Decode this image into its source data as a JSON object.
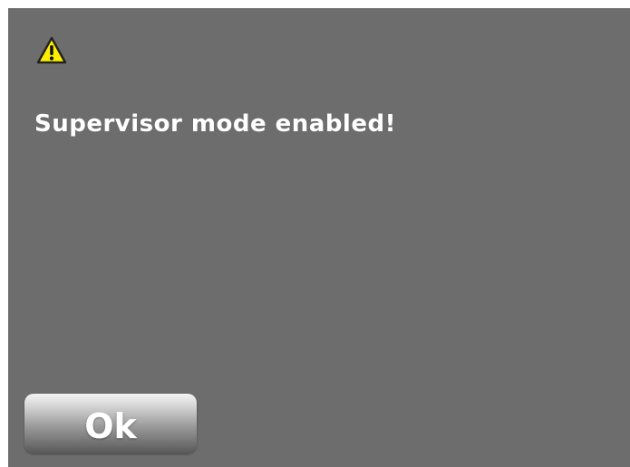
{
  "dialog": {
    "icon": "warning-icon",
    "message": "Supervisor mode enabled!",
    "ok_label": "Ok"
  },
  "colors": {
    "dialog_background": "#6d6d6d",
    "text": "#ffffff",
    "warning_fill": "#ffee00"
  }
}
